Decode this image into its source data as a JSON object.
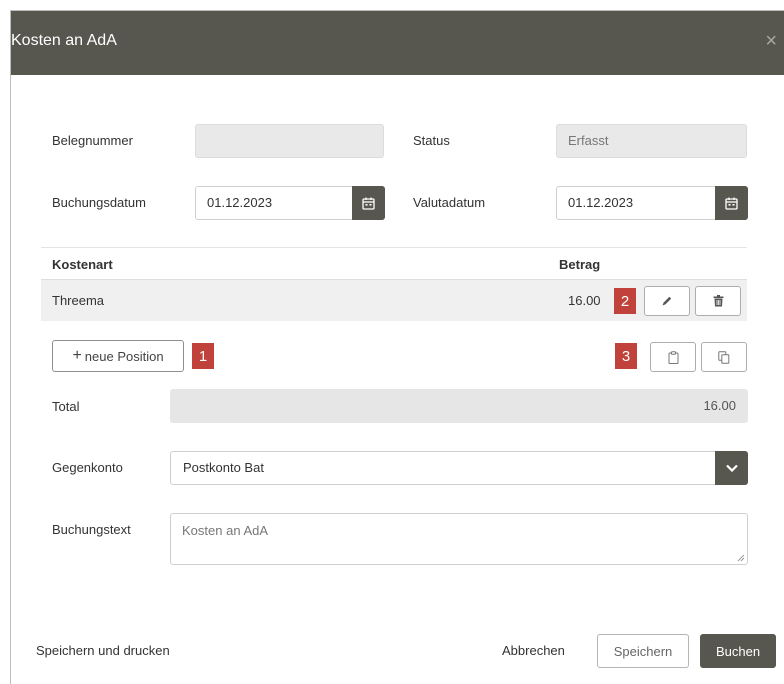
{
  "colors": {
    "header_bg": "#57574f",
    "badge_bg": "#c0423a",
    "readonly_bg": "#e9e9e9"
  },
  "dialog": {
    "title": "Kosten an AdA",
    "close_glyph": "×"
  },
  "form": {
    "belegnummer": {
      "label": "Belegnummer",
      "value": ""
    },
    "status": {
      "label": "Status",
      "value": "Erfasst"
    },
    "buchungsdatum": {
      "label": "Buchungsdatum",
      "value": "01.12.2023"
    },
    "valutadatum": {
      "label": "Valutadatum",
      "value": "01.12.2023"
    }
  },
  "table": {
    "columns": [
      "Kostenart",
      "Betrag"
    ],
    "rows": [
      {
        "kostenart": "Threema",
        "betrag": "16.00"
      }
    ]
  },
  "badges": [
    "1",
    "2",
    "3"
  ],
  "add_position": {
    "plus": "+",
    "label": "neue Position"
  },
  "total": {
    "label": "Total",
    "value": "16.00"
  },
  "gegenkonto": {
    "label": "Gegenkonto",
    "value": "Postkonto Bat"
  },
  "buchungstext": {
    "label": "Buchungstext",
    "value": "Kosten an AdA"
  },
  "footer": {
    "print": "Speichern und drucken",
    "cancel": "Abbrechen",
    "save": "Speichern",
    "book": "Buchen"
  },
  "icons": {
    "calendar": "calendar-icon",
    "edit": "pencil-icon",
    "delete": "trash-icon",
    "paste": "clipboard-icon",
    "copy": "copy-icon",
    "dropdown": "chevron-down-icon"
  }
}
